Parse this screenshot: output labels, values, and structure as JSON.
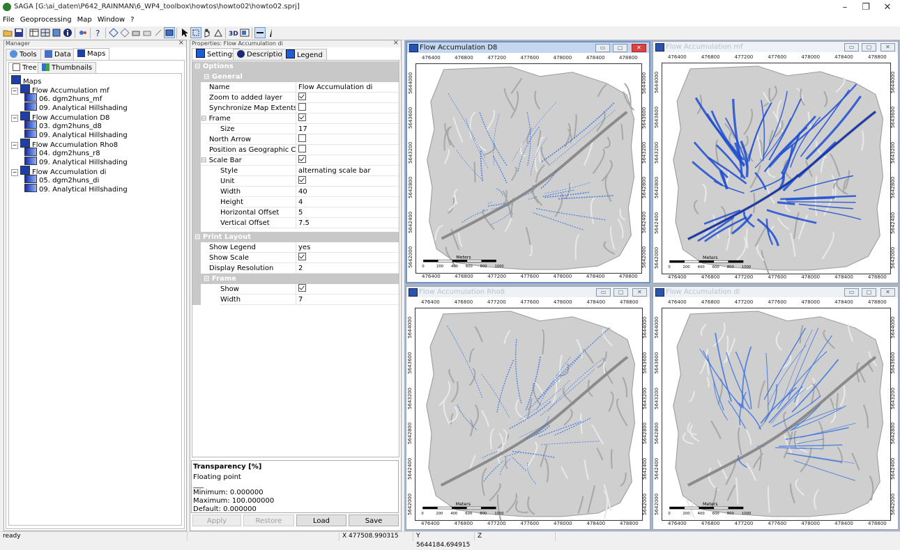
{
  "window": {
    "title": "SAGA [G:\\ai_daten\\P642_RAINMAN\\6_WP4_toolbox\\howtos\\howto02\\howto02.sprj]",
    "minimize": "–",
    "restore": "❐",
    "close": "✕"
  },
  "menu": [
    "File",
    "Geoprocessing",
    "Map",
    "Window",
    "?"
  ],
  "manager": {
    "title": "Manager",
    "close": "×",
    "tabs": [
      "Tools",
      "Data",
      "Maps"
    ],
    "subtabs": [
      "Tree",
      "Thumbnails"
    ],
    "root": "Maps",
    "maps": [
      {
        "name": "Flow Accumulation mf",
        "layers": [
          "06. dgm2huns_mf",
          "09. Analytical Hillshading"
        ]
      },
      {
        "name": "Flow Accumulation D8",
        "layers": [
          "03. dgm2huns_d8",
          "09. Analytical Hillshading"
        ]
      },
      {
        "name": "Flow Accumulation Rho8",
        "layers": [
          "04. dgm2huns_r8",
          "09. Analytical Hillshading"
        ]
      },
      {
        "name": "Flow Accumulation di",
        "layers": [
          "05. dgm2huns_di",
          "09. Analytical Hillshading"
        ]
      }
    ]
  },
  "properties": {
    "title": "Properties: Flow Accumulation di",
    "close": "×",
    "tabs": [
      "Settings",
      "Description",
      "Legend"
    ],
    "cat_options": "Options",
    "cat_general": "General",
    "rows": {
      "name": {
        "label": "Name",
        "value": "Flow Accumulation di"
      },
      "zoom": {
        "label": "Zoom to added layer"
      },
      "sync": {
        "label": "Synchronize Map Extents"
      },
      "frame": {
        "label": "Frame"
      },
      "size": {
        "label": "Size",
        "value": "17"
      },
      "north": {
        "label": "North Arrow"
      },
      "geo": {
        "label": "Position as Geographic Coorc"
      },
      "scalebar": {
        "label": "Scale Bar"
      },
      "style": {
        "label": "Style",
        "value": "alternating scale bar"
      },
      "unit": {
        "label": "Unit"
      },
      "width": {
        "label": "Width",
        "value": "40"
      },
      "height": {
        "label": "Height",
        "value": "4"
      },
      "hoff": {
        "label": "Horizontal Offset",
        "value": "5"
      },
      "voff": {
        "label": "Vertical Offset",
        "value": "7.5"
      },
      "cat_print": "Print Layout",
      "legend": {
        "label": "Show Legend",
        "value": "yes"
      },
      "showscale": {
        "label": "Show Scale"
      },
      "res": {
        "label": "Display Resolution",
        "value": "2"
      },
      "cat_frame": "Frame",
      "fshow": {
        "label": "Show"
      },
      "fwidth": {
        "label": "Width",
        "value": "7"
      }
    },
    "checks": {
      "zoom": true,
      "sync": false,
      "frame": true,
      "north": false,
      "geo": false,
      "scalebar": true,
      "unit": true,
      "showscale": true,
      "fshow": true
    },
    "info": {
      "heading": "Transparency [%]",
      "type": "Floating point",
      "dash": "___",
      "min": "Minimum: 0.000000",
      "max": "Maximum: 100.000000",
      "default": "Default: 0.000000"
    },
    "buttons": {
      "apply": "Apply",
      "restore": "Restore",
      "load": "Load",
      "save": "Save"
    }
  },
  "maps": [
    {
      "title": "Flow Accumulation D8",
      "active": true,
      "density": 0.5
    },
    {
      "title": "Flow Accumulation mf",
      "active": false,
      "density": 1.0
    },
    {
      "title": "Flow Accumulation Rho8",
      "active": false,
      "density": 0.45
    },
    {
      "title": "Flow Accumulation di",
      "active": false,
      "density": 0.75
    }
  ],
  "map_axes": {
    "x_ticks": [
      "476400",
      "476800",
      "477200",
      "477600",
      "478000",
      "478400",
      "478800"
    ],
    "y_ticks": [
      "5644000",
      "5643600",
      "5643200",
      "5642800",
      "5642400",
      "5642000"
    ],
    "scale_label": "Meters",
    "scale_ticks": [
      "0",
      "200",
      "400",
      "600",
      "800",
      "1000"
    ]
  },
  "status": {
    "ready": "ready",
    "x": "X 477508.990315",
    "y": "Y 5644184.694915",
    "z": "Z"
  }
}
